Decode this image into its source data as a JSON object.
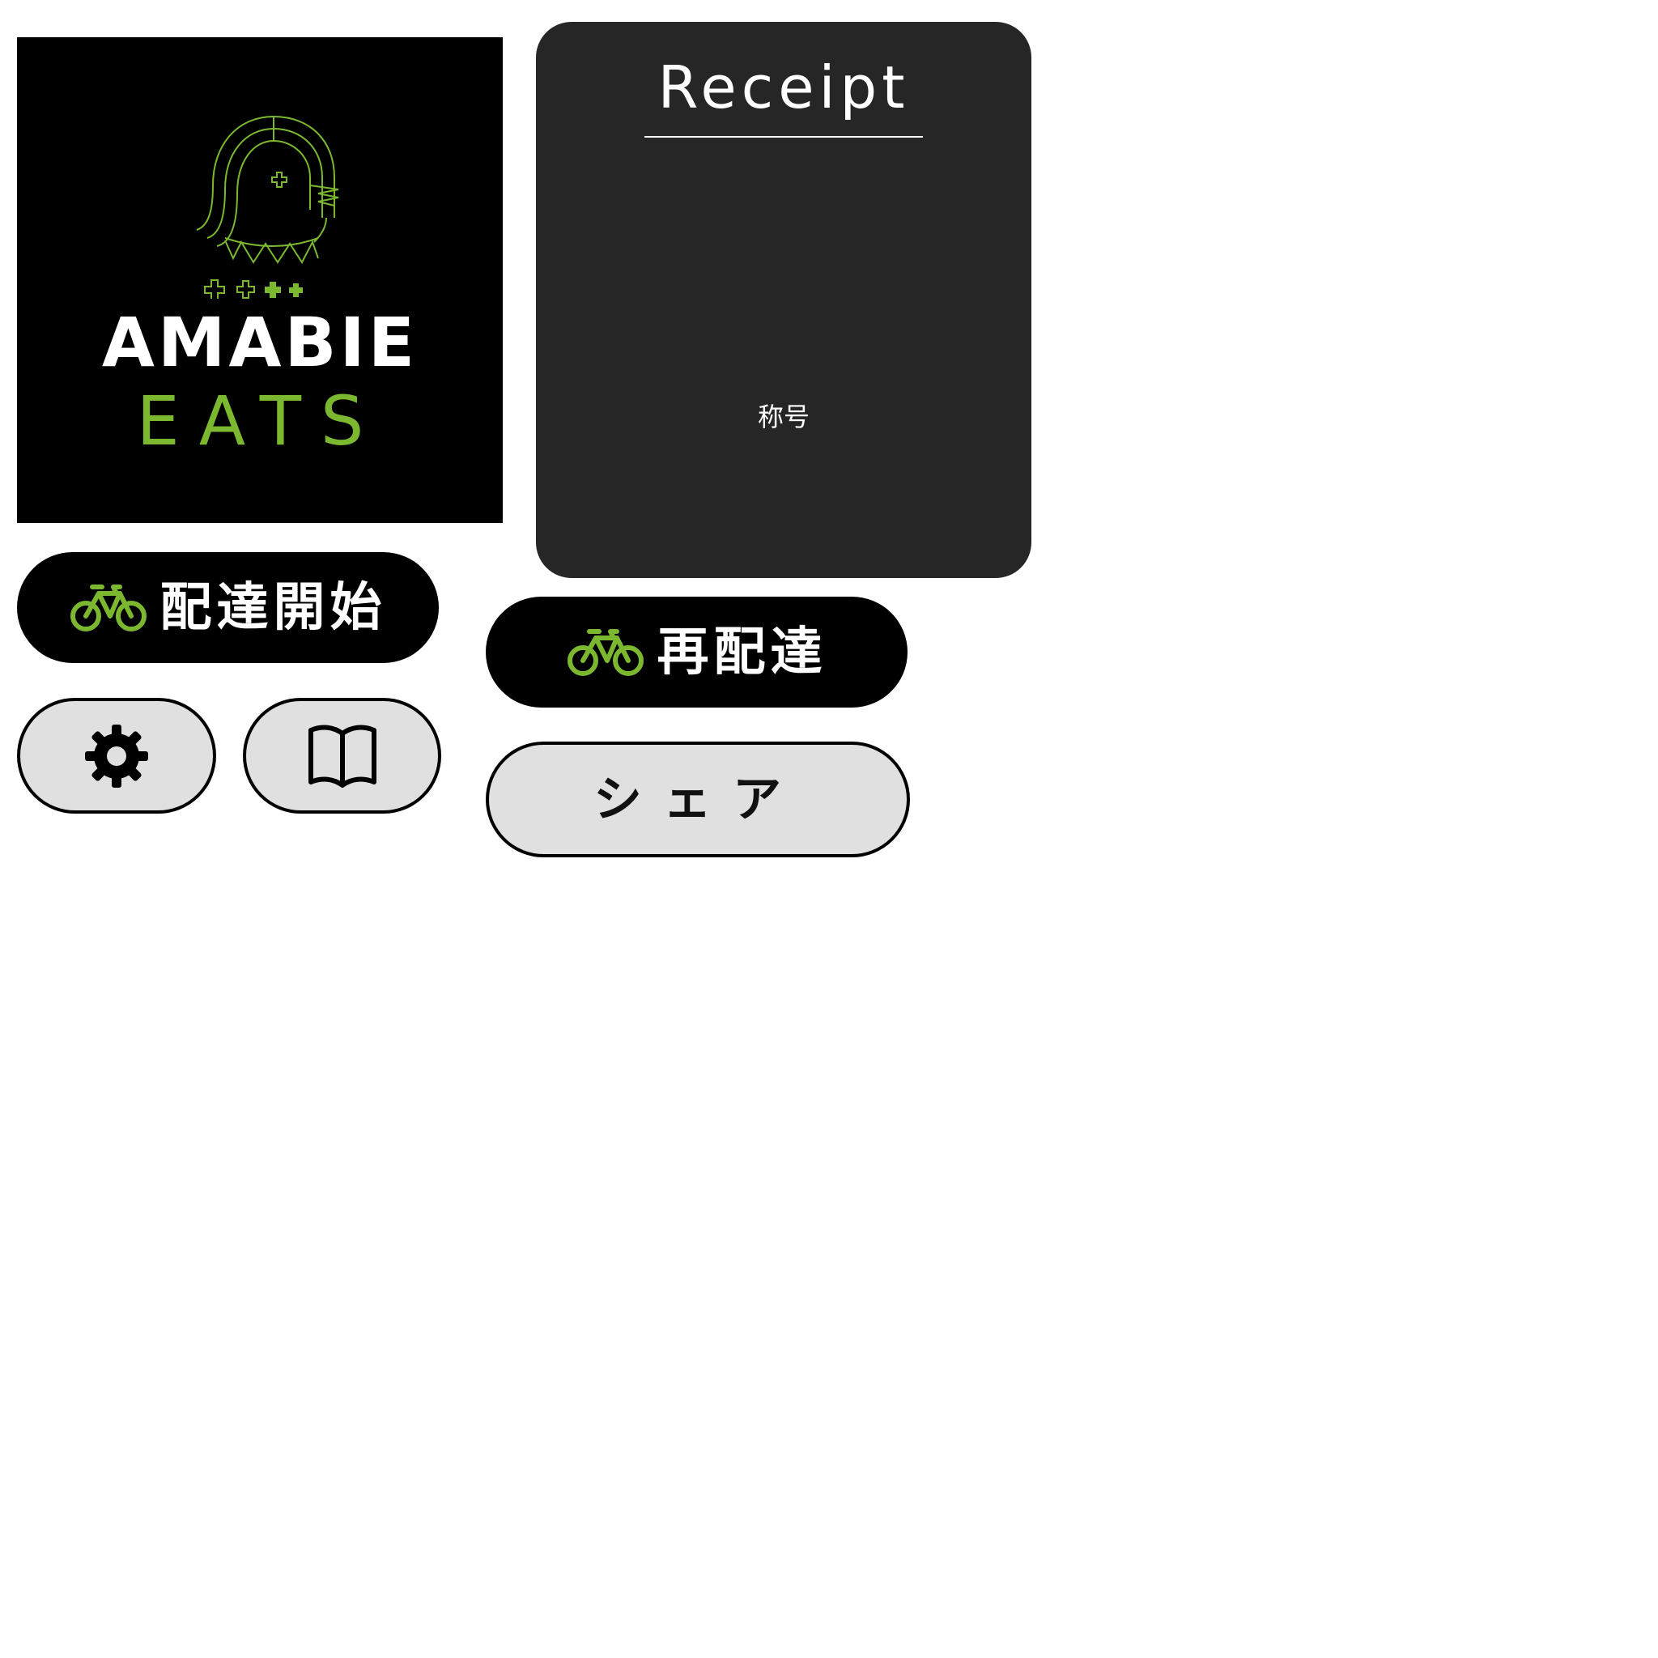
{
  "logo": {
    "icon": "amabie-mascot",
    "brand_line_1": "AMABIE",
    "brand_line_2": "EATS",
    "colors": {
      "background": "#000000",
      "accent": "#7cb82f",
      "text": "#ffffff"
    }
  },
  "receipt": {
    "title": "Receipt",
    "label": "称号",
    "background": "#262626"
  },
  "buttons": {
    "start_delivery": {
      "icon": "bicycle-icon",
      "label": "配達開始"
    },
    "redelivery": {
      "icon": "bicycle-icon",
      "label": "再配達"
    },
    "settings": {
      "icon": "gear-icon"
    },
    "guide": {
      "icon": "book-icon"
    },
    "share": {
      "label": "シェア"
    }
  },
  "colors": {
    "accent": "#7cb82f",
    "button_dark": "#000000",
    "button_light": "#e0e0e0",
    "border": "#000000"
  }
}
